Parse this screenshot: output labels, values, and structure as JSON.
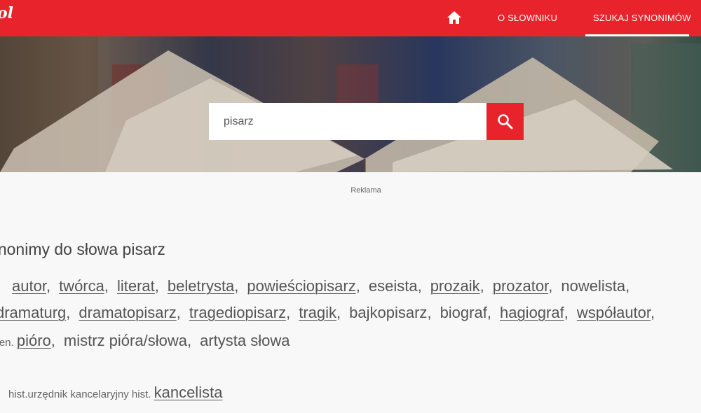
{
  "nav": {
    "logo": "ol",
    "home_icon": "home-icon",
    "about_label": "O SŁOWNIKU",
    "search_label": "SZUKAJ SYNONIMÓW",
    "accent": "#e8232b"
  },
  "search": {
    "value": "pisarz",
    "button_icon": "search-icon"
  },
  "ad_label": "Reklama",
  "heading": "Synonimy do słowa pisarz",
  "synonyms": {
    "line1": [
      {
        "text": "autor",
        "link": true
      },
      {
        "text": "twórca",
        "link": true
      },
      {
        "text": "literat",
        "link": true
      },
      {
        "text": "beletrysta",
        "link": true
      },
      {
        "text": "powieściopisarz",
        "link": true
      },
      {
        "text": "eseista",
        "link": false
      },
      {
        "text": "prozaik",
        "link": true
      },
      {
        "text": "prozator",
        "link": true
      },
      {
        "text": "nowelista",
        "link": false
      }
    ],
    "line2": [
      {
        "text": "dramaturg",
        "link": true
      },
      {
        "text": "dramatopisarz",
        "link": true
      },
      {
        "text": "tragediopisarz",
        "link": true
      },
      {
        "text": "tragik",
        "link": true
      },
      {
        "text": "bajkopisarz",
        "link": false
      },
      {
        "text": "biograf",
        "link": false
      },
      {
        "text": "hagiograf",
        "link": true
      },
      {
        "text": "współautor",
        "link": true
      }
    ],
    "line3_prefix": "przen.",
    "line3": [
      {
        "text": "pióro",
        "link": true
      },
      {
        "text": "mistrz pióra/słowa",
        "link": false
      },
      {
        "text": "artysta słowa",
        "link": false
      }
    ],
    "line4_prefix": "hist.urzędnik kancelaryjny hist.",
    "line4": [
      {
        "text": "kancelista",
        "link": true
      }
    ]
  }
}
